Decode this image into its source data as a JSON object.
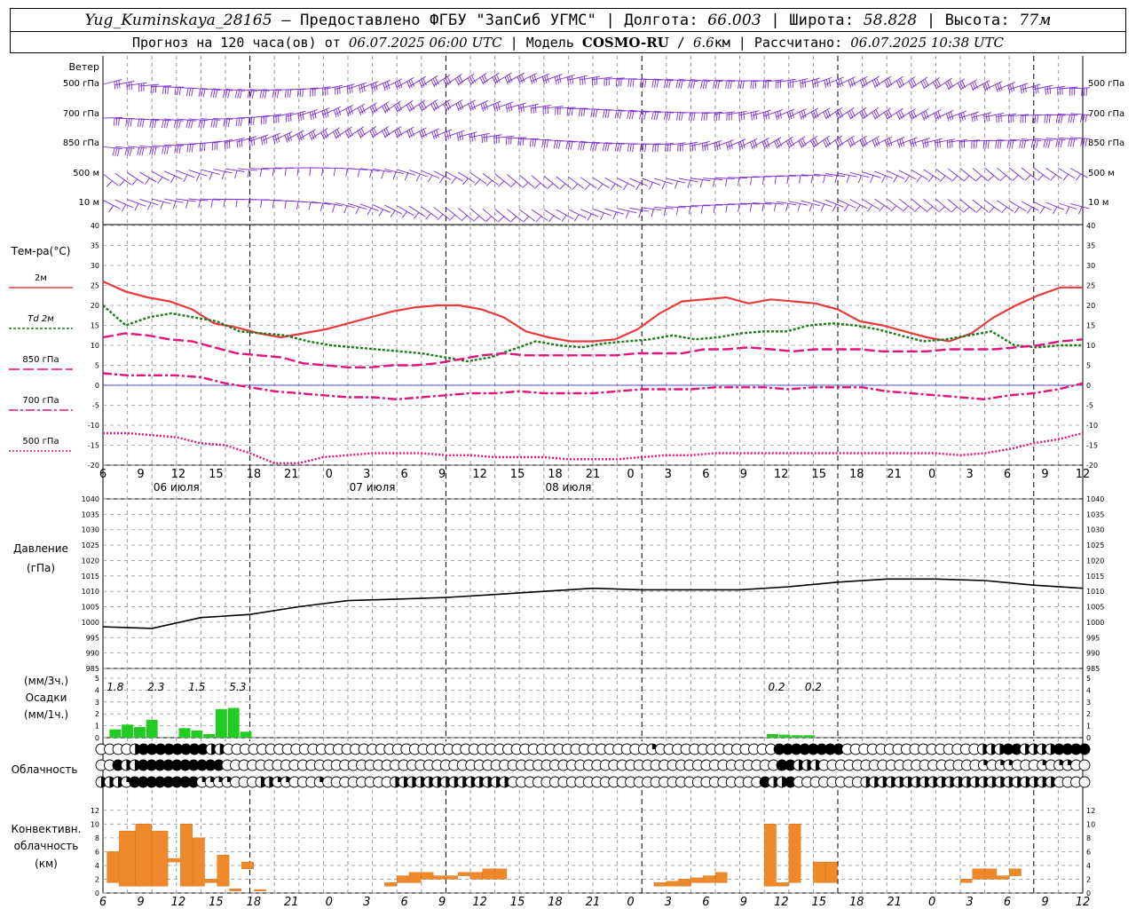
{
  "header": {
    "station": "Yug_Kuminskaya_28165",
    "dash": " – ",
    "provider": "Предоставлено ФГБУ \"ЗапСиб УГМС\"",
    "lon_label": "Долгота:",
    "lon": "66.003",
    "lat_label": "Широта:",
    "lat": "58.828",
    "alt_label": "Высота:",
    "alt": "77м",
    "forecast_prefix": "Прогноз на 120 часа(ов) от",
    "forecast_from": "06.07.2025 06:00 UTC",
    "model_label": "Модель",
    "model": "COSMO-RU",
    "resolution": "6.6",
    "resolution_unit": "км",
    "calc_label": "Рассчитано:",
    "calc": "06.07.2025 10:38 UTC"
  },
  "labels": {
    "wind_title": "Ветер",
    "wind_levels": [
      "500 гПа",
      "700 гПа",
      "850 гПа",
      "500 м",
      "10  м"
    ],
    "temp_title": "Тем-ра(°C)",
    "temp_legend": [
      "2м",
      "Td  2м",
      "850 гПа",
      "700 гПа",
      "500 гПа"
    ],
    "pressure_title": "Давление",
    "pressure_unit": "(гПа)",
    "precip_unit_top": "(мм/3ч.)",
    "precip_title": "Осадки",
    "precip_unit_bottom": "(мм/1ч.)",
    "cloud_title": "Облачность",
    "conv_title_1": "Конвективн.",
    "conv_title_2": "облачность",
    "conv_unit": "(км)"
  },
  "colors": {
    "wind": "#7b2fd0",
    "t2m": "#e8393c",
    "td2m": "#1d7a1d",
    "t850": "#e2137b",
    "t700": "#e2137b",
    "t500": "#e2137b",
    "zero_line": "#2222cc",
    "pressure": "#000000",
    "precip": "#22cc22",
    "conv": "#f0892a",
    "grid": "#999999"
  },
  "chart_data": [
    {
      "type": "line",
      "title": "Тем-ра(°C)",
      "time_hours": [
        0,
        3,
        6,
        9,
        12,
        15,
        18,
        21,
        24,
        27,
        30,
        33,
        36,
        39,
        42,
        45,
        48,
        51,
        54,
        57,
        60,
        63,
        66,
        69,
        72,
        75,
        78,
        81,
        84,
        87,
        90,
        93,
        96,
        99,
        102,
        105,
        108,
        111,
        114,
        117,
        120
      ],
      "ylim": [
        -20,
        40
      ],
      "series": [
        {
          "name": "2м",
          "values": [
            26,
            23.5,
            22,
            21,
            19,
            15.5,
            14.5,
            13,
            12,
            13,
            14,
            15.5,
            17,
            18.5,
            19.5,
            20,
            20,
            19,
            17,
            13.5,
            12,
            11,
            11,
            11.5,
            14,
            18,
            21,
            21.5,
            22,
            20.5,
            21.5,
            21,
            20.5,
            19,
            16,
            15,
            13.5,
            12,
            11,
            13,
            17,
            20,
            22.5,
            24.5,
            24.5
          ]
        },
        {
          "name": "Td  2м",
          "values": [
            20,
            15,
            17,
            18,
            17,
            16,
            13.5,
            13,
            12.5,
            11,
            10,
            9.5,
            9,
            8.5,
            8,
            7,
            6,
            7,
            9,
            11,
            10,
            9.5,
            10.5,
            11,
            11.5,
            12.5,
            11.5,
            12,
            13,
            13.5,
            13.5,
            15,
            15.5,
            15,
            14,
            12.5,
            11,
            11.5,
            12.5,
            13.5,
            10,
            9.5,
            10,
            10
          ]
        },
        {
          "name": "850 гПа",
          "values": [
            12,
            13,
            12.5,
            11.5,
            11,
            9.5,
            8,
            7.5,
            7,
            5.5,
            5,
            4.5,
            4.5,
            5,
            5,
            5.5,
            6.5,
            7.5,
            8,
            7.5,
            7.5,
            7.5,
            7.5,
            7.5,
            8,
            8,
            8,
            9,
            9,
            9.5,
            9,
            8.5,
            9,
            9,
            9,
            8.5,
            8.5,
            8.5,
            9,
            9,
            9,
            9.5,
            10,
            11,
            11.5
          ]
        },
        {
          "name": "700 гПа",
          "values": [
            3,
            2.5,
            2.5,
            2.5,
            2,
            0.5,
            -0.5,
            -1.5,
            -2,
            -2.5,
            -3,
            -3,
            -3.5,
            -3,
            -2.5,
            -2,
            -2,
            -1.5,
            -2,
            -2,
            -2,
            -1.5,
            -1,
            -1,
            -1,
            -0.5,
            -0.5,
            -0.5,
            -1,
            -0.5,
            -0.5,
            -0.5,
            -1.5,
            -2,
            -2.5,
            -3,
            -3.5,
            -2.5,
            -2,
            -1,
            0.5
          ]
        },
        {
          "name": "500 гПа",
          "values": [
            -12,
            -12,
            -12.5,
            -13,
            -14.5,
            -15,
            -17,
            -19.5,
            -19.5,
            -18,
            -17.5,
            -17,
            -17,
            -17,
            -17.5,
            -17.5,
            -18,
            -18,
            -18,
            -18.5,
            -18.5,
            -18.5,
            -18,
            -17.5,
            -17.5,
            -17,
            -17,
            -17,
            -17,
            -17,
            -17,
            -17,
            -17,
            -17,
            -17,
            -17.5,
            -17,
            -16,
            -14.5,
            -13.5,
            -12
          ]
        }
      ]
    },
    {
      "type": "line",
      "title": "Давление",
      "ylabel": "(гПа)",
      "ylim": [
        985,
        1040
      ],
      "time_hours": [
        0,
        6,
        12,
        18,
        24,
        30,
        36,
        42,
        48,
        54,
        60,
        66,
        72,
        78,
        84,
        90,
        96,
        102,
        108,
        114,
        120
      ],
      "values": [
        998.5,
        998,
        1001.5,
        1002.5,
        1005,
        1007,
        1007.5,
        1008,
        1009,
        1010,
        1011,
        1010.5,
        1010.5,
        1010.5,
        1011.5,
        1013,
        1014,
        1014,
        1013.5,
        1012,
        1011
      ]
    },
    {
      "type": "bar",
      "title": "Осадки",
      "ylabel": "(мм/1ч.)",
      "ylim": [
        0,
        5
      ],
      "time_hours": [
        1.5,
        3,
        4.5,
        6,
        10,
        11.5,
        13,
        14.5,
        16,
        17.5,
        82,
        83.5,
        85,
        86.5
      ],
      "values": [
        0.7,
        1.1,
        0.9,
        1.5,
        0.8,
        0.6,
        0.3,
        2.4,
        2.5,
        0.5,
        0.3,
        0.25,
        0.2,
        0.2
      ],
      "annotations": [
        {
          "time": 1.5,
          "text": "1.8"
        },
        {
          "time": 6.5,
          "text": "2.3"
        },
        {
          "time": 11.5,
          "text": "1.5"
        },
        {
          "time": 16.5,
          "text": "5.3"
        },
        {
          "time": 82.5,
          "text": "0.2"
        },
        {
          "time": 87,
          "text": "0.2"
        }
      ]
    },
    {
      "type": "bar",
      "title": "Конвективн. облачность",
      "ylabel": "(км)",
      "ylim": [
        0,
        13
      ],
      "bars": [
        {
          "t0": 0.5,
          "t1": 2,
          "base": 1.5,
          "top": 6
        },
        {
          "t0": 2,
          "t1": 4,
          "base": 1,
          "top": 9
        },
        {
          "t0": 4,
          "t1": 6,
          "base": 1,
          "top": 10
        },
        {
          "t0": 6,
          "t1": 8,
          "base": 1,
          "top": 9
        },
        {
          "t0": 8,
          "t1": 9.5,
          "base": 4.5,
          "top": 5
        },
        {
          "t0": 9.5,
          "t1": 11,
          "base": 1,
          "top": 10
        },
        {
          "t0": 11,
          "t1": 12.5,
          "base": 1,
          "top": 8
        },
        {
          "t0": 12.5,
          "t1": 14,
          "base": 1.5,
          "top": 2
        },
        {
          "t0": 14,
          "t1": 15.5,
          "base": 1,
          "top": 5.5
        },
        {
          "t0": 15.5,
          "t1": 17,
          "base": 0.3,
          "top": 0.6
        },
        {
          "t0": 17,
          "t1": 18.5,
          "base": 3.5,
          "top": 4.5
        },
        {
          "t0": 18.5,
          "t1": 20,
          "base": 0.3,
          "top": 0.5
        },
        {
          "t0": 34.5,
          "t1": 36,
          "base": 1,
          "top": 1.5
        },
        {
          "t0": 36,
          "t1": 37.5,
          "base": 1.5,
          "top": 2.5
        },
        {
          "t0": 37.5,
          "t1": 39,
          "base": 1.5,
          "top": 3
        },
        {
          "t0": 39,
          "t1": 40.5,
          "base": 2,
          "top": 3
        },
        {
          "t0": 40.5,
          "t1": 42,
          "base": 2,
          "top": 2.5
        },
        {
          "t0": 42,
          "t1": 43.5,
          "base": 2,
          "top": 2.5
        },
        {
          "t0": 43.5,
          "t1": 45,
          "base": 2.5,
          "top": 3
        },
        {
          "t0": 45,
          "t1": 46.5,
          "base": 2,
          "top": 3
        },
        {
          "t0": 46.5,
          "t1": 48,
          "base": 2,
          "top": 3.5
        },
        {
          "t0": 48,
          "t1": 49.5,
          "base": 2,
          "top": 3.5
        },
        {
          "t0": 67.5,
          "t1": 69,
          "base": 1,
          "top": 1.5
        },
        {
          "t0": 69,
          "t1": 70.5,
          "base": 1,
          "top": 1.7
        },
        {
          "t0": 70.5,
          "t1": 72,
          "base": 1,
          "top": 2
        },
        {
          "t0": 72,
          "t1": 73.5,
          "base": 1.5,
          "top": 2.2
        },
        {
          "t0": 73.5,
          "t1": 75,
          "base": 1.5,
          "top": 2.5
        },
        {
          "t0": 75,
          "t1": 76.5,
          "base": 1.5,
          "top": 3
        },
        {
          "t0": 81,
          "t1": 82.5,
          "base": 1,
          "top": 10
        },
        {
          "t0": 82.5,
          "t1": 84,
          "base": 1,
          "top": 1.5
        },
        {
          "t0": 84,
          "t1": 85.5,
          "base": 1.5,
          "top": 10
        },
        {
          "t0": 87,
          "t1": 88.5,
          "base": 1.5,
          "top": 4.5
        },
        {
          "t0": 88.5,
          "t1": 90,
          "base": 1.5,
          "top": 4.5
        },
        {
          "t0": 105,
          "t1": 106.5,
          "base": 1.5,
          "top": 2
        },
        {
          "t0": 106.5,
          "t1": 108,
          "base": 2,
          "top": 3.5
        },
        {
          "t0": 108,
          "t1": 109.5,
          "base": 2,
          "top": 3.5
        },
        {
          "t0": 109.5,
          "t1": 111,
          "base": 2,
          "top": 2.5
        },
        {
          "t0": 111,
          "t1": 112.5,
          "base": 2.5,
          "top": 3.5
        }
      ]
    }
  ],
  "axes": {
    "hour_ticks": [
      "6",
      "9",
      "12",
      "15",
      "18",
      "21",
      "0",
      "3",
      "6",
      "9",
      "12",
      "15",
      "18",
      "21",
      "0",
      "3",
      "6",
      "9",
      "12",
      "15",
      "18",
      "21",
      "0",
      "3",
      "6",
      "9",
      "12"
    ],
    "dates": [
      "06 июля",
      "07 июля",
      "08 июля"
    ],
    "temp_ticks": [
      "40",
      "35",
      "30",
      "25",
      "20",
      "15",
      "10",
      "5",
      "0",
      "-5",
      "-10",
      "-15",
      "-20"
    ],
    "pressure_ticks": [
      "1040",
      "1035",
      "1030",
      "1025",
      "1020",
      "1015",
      "1010",
      "1005",
      "1000",
      "995",
      "990",
      "985"
    ],
    "precip_ticks": [
      "5",
      "4",
      "3",
      "2",
      "1",
      "0"
    ],
    "conv_ticks": [
      "12",
      "10",
      "8",
      "6",
      "4",
      "2",
      "0"
    ]
  },
  "cloud_rows": [
    "eeeehFFFFFFFFhheeeeeeeeeeeeeeeeeeeeeeeeeeeeeeeeeeeeeeeeeeeeeeeeeeqeeeeeeeeeeeeeeFFFFFFFFeeeeeeeeeeeeeeeehhhFFhhhhFFFF",
    "eeFhhFFFFFFFFFFeeeeeeeeeeeeeeeeeeeeeeeeeeeeeeeeeeeeeeeeeeeeeeeeeeeeeeeeeeeeeeeeeeFFhhheeeeeeeeeeeeeeeeeeeqeqqeeeqeqqee",
    "hhhqFFFFFFFFqqqqeeehhqqeeeqeeeeeeeehhhhhhhhhhhhhheeeeeeeeeeeeeeeeeeeeeeeeeeeeeeFhhFeeeeeeeehhhhhhhhhhhhhhhhhhhhhhheeee"
  ]
}
